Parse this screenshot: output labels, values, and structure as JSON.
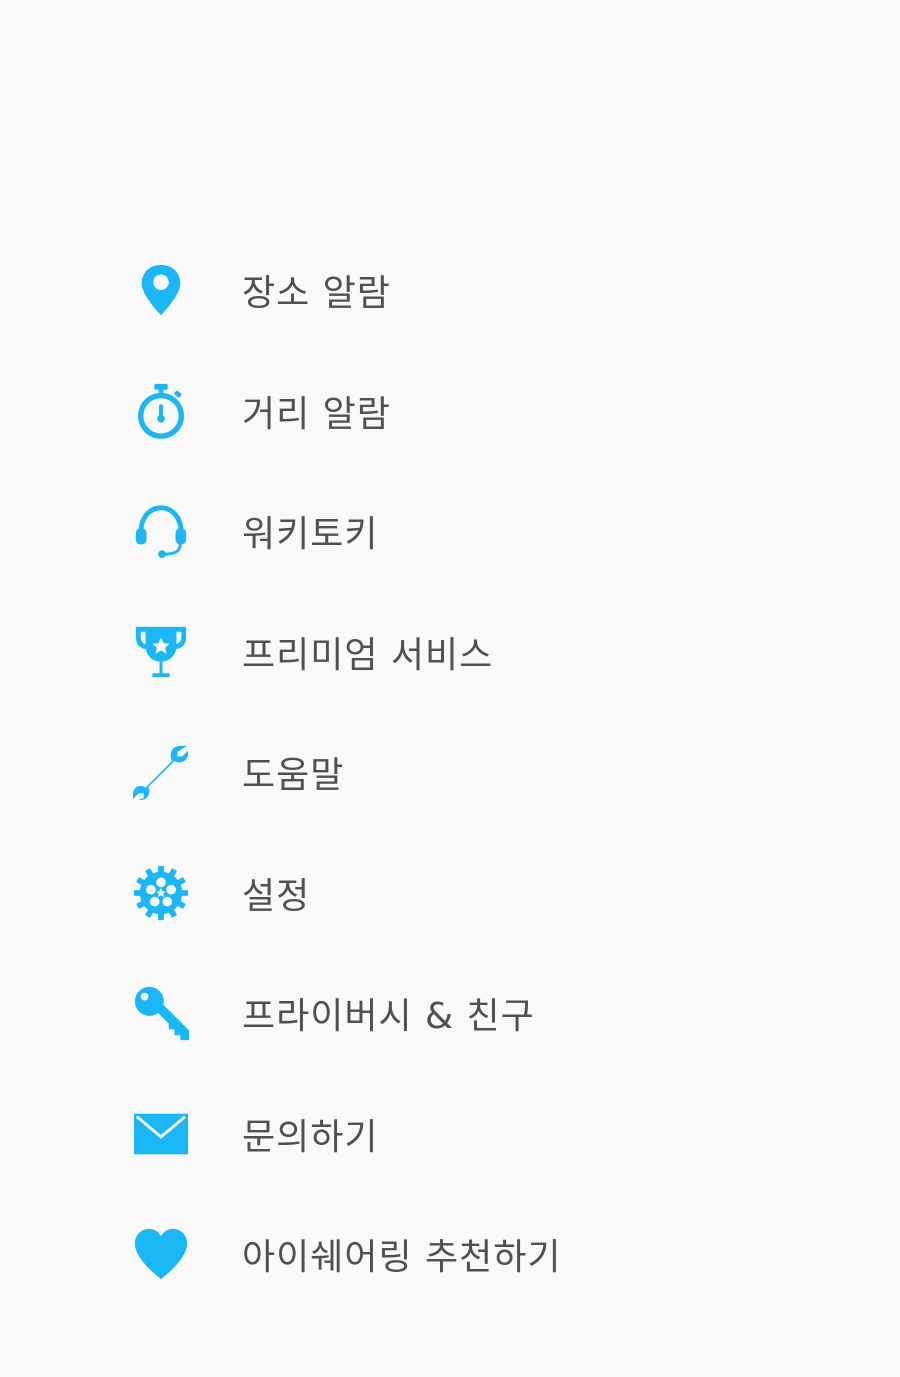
{
  "menu": {
    "accent_color": "#1ab6f5",
    "items": [
      {
        "icon": "location-pin-icon",
        "label": "장소 알람"
      },
      {
        "icon": "stopwatch-icon",
        "label": "거리 알람"
      },
      {
        "icon": "headset-icon",
        "label": "워키토키"
      },
      {
        "icon": "trophy-icon",
        "label": "프리미엄 서비스"
      },
      {
        "icon": "wrench-icon",
        "label": "도움말"
      },
      {
        "icon": "gear-icon",
        "label": "설정"
      },
      {
        "icon": "key-icon",
        "label": "프라이버시 & 친구"
      },
      {
        "icon": "envelope-icon",
        "label": "문의하기"
      },
      {
        "icon": "heart-icon",
        "label": "아이쉐어링 추천하기"
      }
    ]
  }
}
